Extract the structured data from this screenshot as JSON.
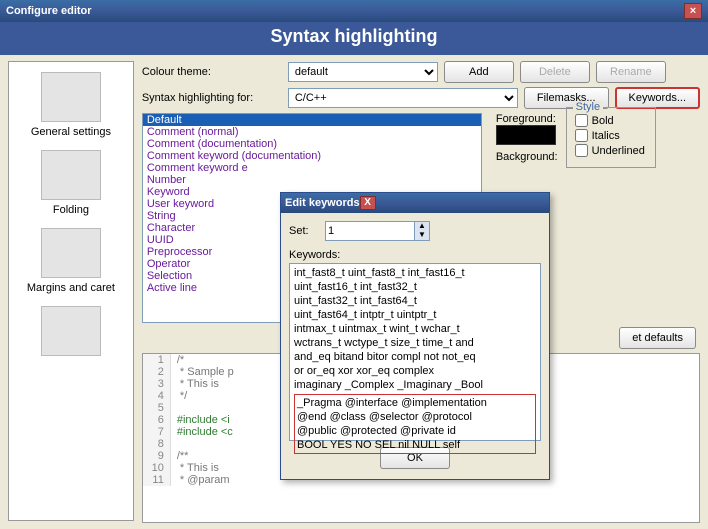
{
  "window": {
    "title": "Configure editor",
    "header": "Syntax highlighting"
  },
  "sidebar": {
    "items": [
      {
        "label": "General settings"
      },
      {
        "label": "Folding"
      },
      {
        "label": "Margins and caret"
      },
      {
        "label": ""
      }
    ]
  },
  "labels": {
    "colour_theme": "Colour theme:",
    "syntax_for": "Syntax highlighting for:",
    "foreground": "Foreground:",
    "background": "Background:",
    "style": "Style",
    "bold": "Bold",
    "italics": "Italics",
    "underlined": "Underlined"
  },
  "theme": {
    "value": "default"
  },
  "lang": {
    "value": "C/C++"
  },
  "buttons": {
    "add": "Add",
    "delete": "Delete",
    "rename": "Rename",
    "filemasks": "Filemasks...",
    "keywords": "Keywords...",
    "defaults": "et defaults",
    "ok": "OK"
  },
  "syntax_items": [
    "Default",
    "Comment (normal)",
    "Comment (documentation)",
    "Comment keyword (documentation)",
    "Comment keyword e",
    "Number",
    "Keyword",
    "User keyword",
    "String",
    "Character",
    "UUID",
    "Preprocessor",
    "Operator",
    "Selection",
    "Active line"
  ],
  "code": [
    {
      "n": 1,
      "cls": "cmt",
      "t": "/*"
    },
    {
      "n": 2,
      "cls": "cmt",
      "t": " * Sample p"
    },
    {
      "n": 3,
      "cls": "cmt",
      "t": " * This is"
    },
    {
      "n": 4,
      "cls": "cmt",
      "t": " */"
    },
    {
      "n": 5,
      "cls": "",
      "t": ""
    },
    {
      "n": 6,
      "cls": "inc",
      "t": "#include <i"
    },
    {
      "n": 7,
      "cls": "inc",
      "t": "#include <c"
    },
    {
      "n": 8,
      "cls": "",
      "t": ""
    },
    {
      "n": 9,
      "cls": "cmt",
      "t": "/**"
    },
    {
      "n": 10,
      "cls": "cmt",
      "t": " * This is"
    },
    {
      "n": 11,
      "cls": "cmt",
      "t": " * @param"
    }
  ],
  "dialog": {
    "title": "Edit keywords",
    "set_label": "Set:",
    "set_value": "1",
    "keywords_label": "Keywords:",
    "kw_plain": [
      "int_fast8_t uint_fast8_t int_fast16_t",
      "uint_fast16_t int_fast32_t",
      "uint_fast32_t int_fast64_t",
      "uint_fast64_t intptr_t uintptr_t",
      "intmax_t uintmax_t wint_t wchar_t",
      "wctrans_t wctype_t size_t time_t and",
      "and_eq bitand bitor compl not not_eq",
      "or or_eq xor xor_eq complex",
      "imaginary _Complex _Imaginary _Bool"
    ],
    "kw_red": [
      "_Pragma @interface @implementation",
      "@end @class @selector @protocol",
      "@public @protected @private id",
      "BOOL YES NO SEL nil NULL self"
    ]
  }
}
